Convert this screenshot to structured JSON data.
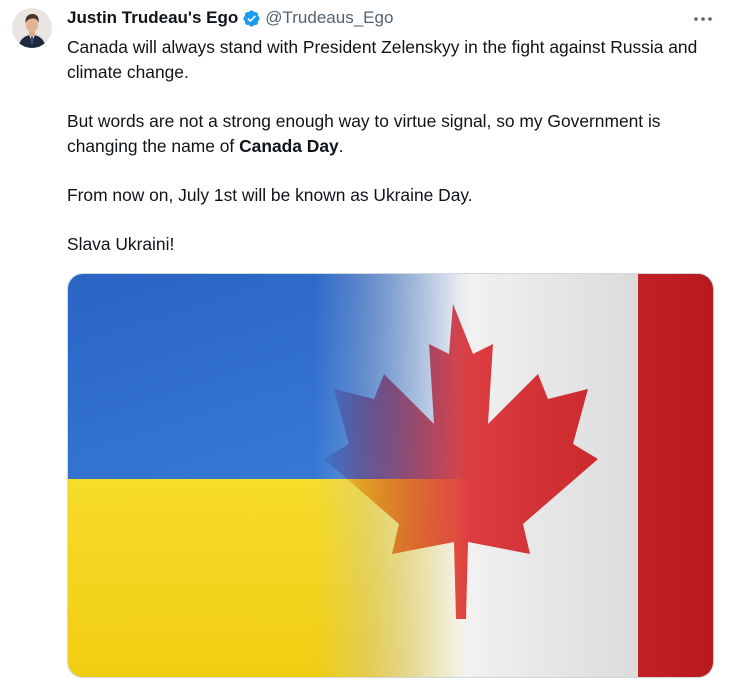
{
  "tweet": {
    "author": {
      "display_name": "Justin Trudeau's Ego",
      "handle": "@Trudeaus_Ego",
      "verified": true,
      "verified_color": "#1d9bf0"
    },
    "more_icon": "more-horizontal-icon",
    "paragraphs": {
      "p1": "Canada will always stand with President Zelenskyy in the fight against Russia and climate change.",
      "p2_before": "But words are not a strong enough way to virtue signal, so my Government is changing the name of ",
      "p2_bold": "Canada Day",
      "p2_after": ".",
      "p3": "From now on, July 1st will be known as Ukraine Day.",
      "p4": "Slava Ukraini!"
    },
    "media": {
      "description_icon": "ukraine-canada-flag-image",
      "colors": {
        "ukraine_blue": "#2f6fd0",
        "ukraine_yellow": "#f4d41a",
        "canada_red": "#d81e23",
        "white": "#f2f2f2"
      }
    }
  }
}
